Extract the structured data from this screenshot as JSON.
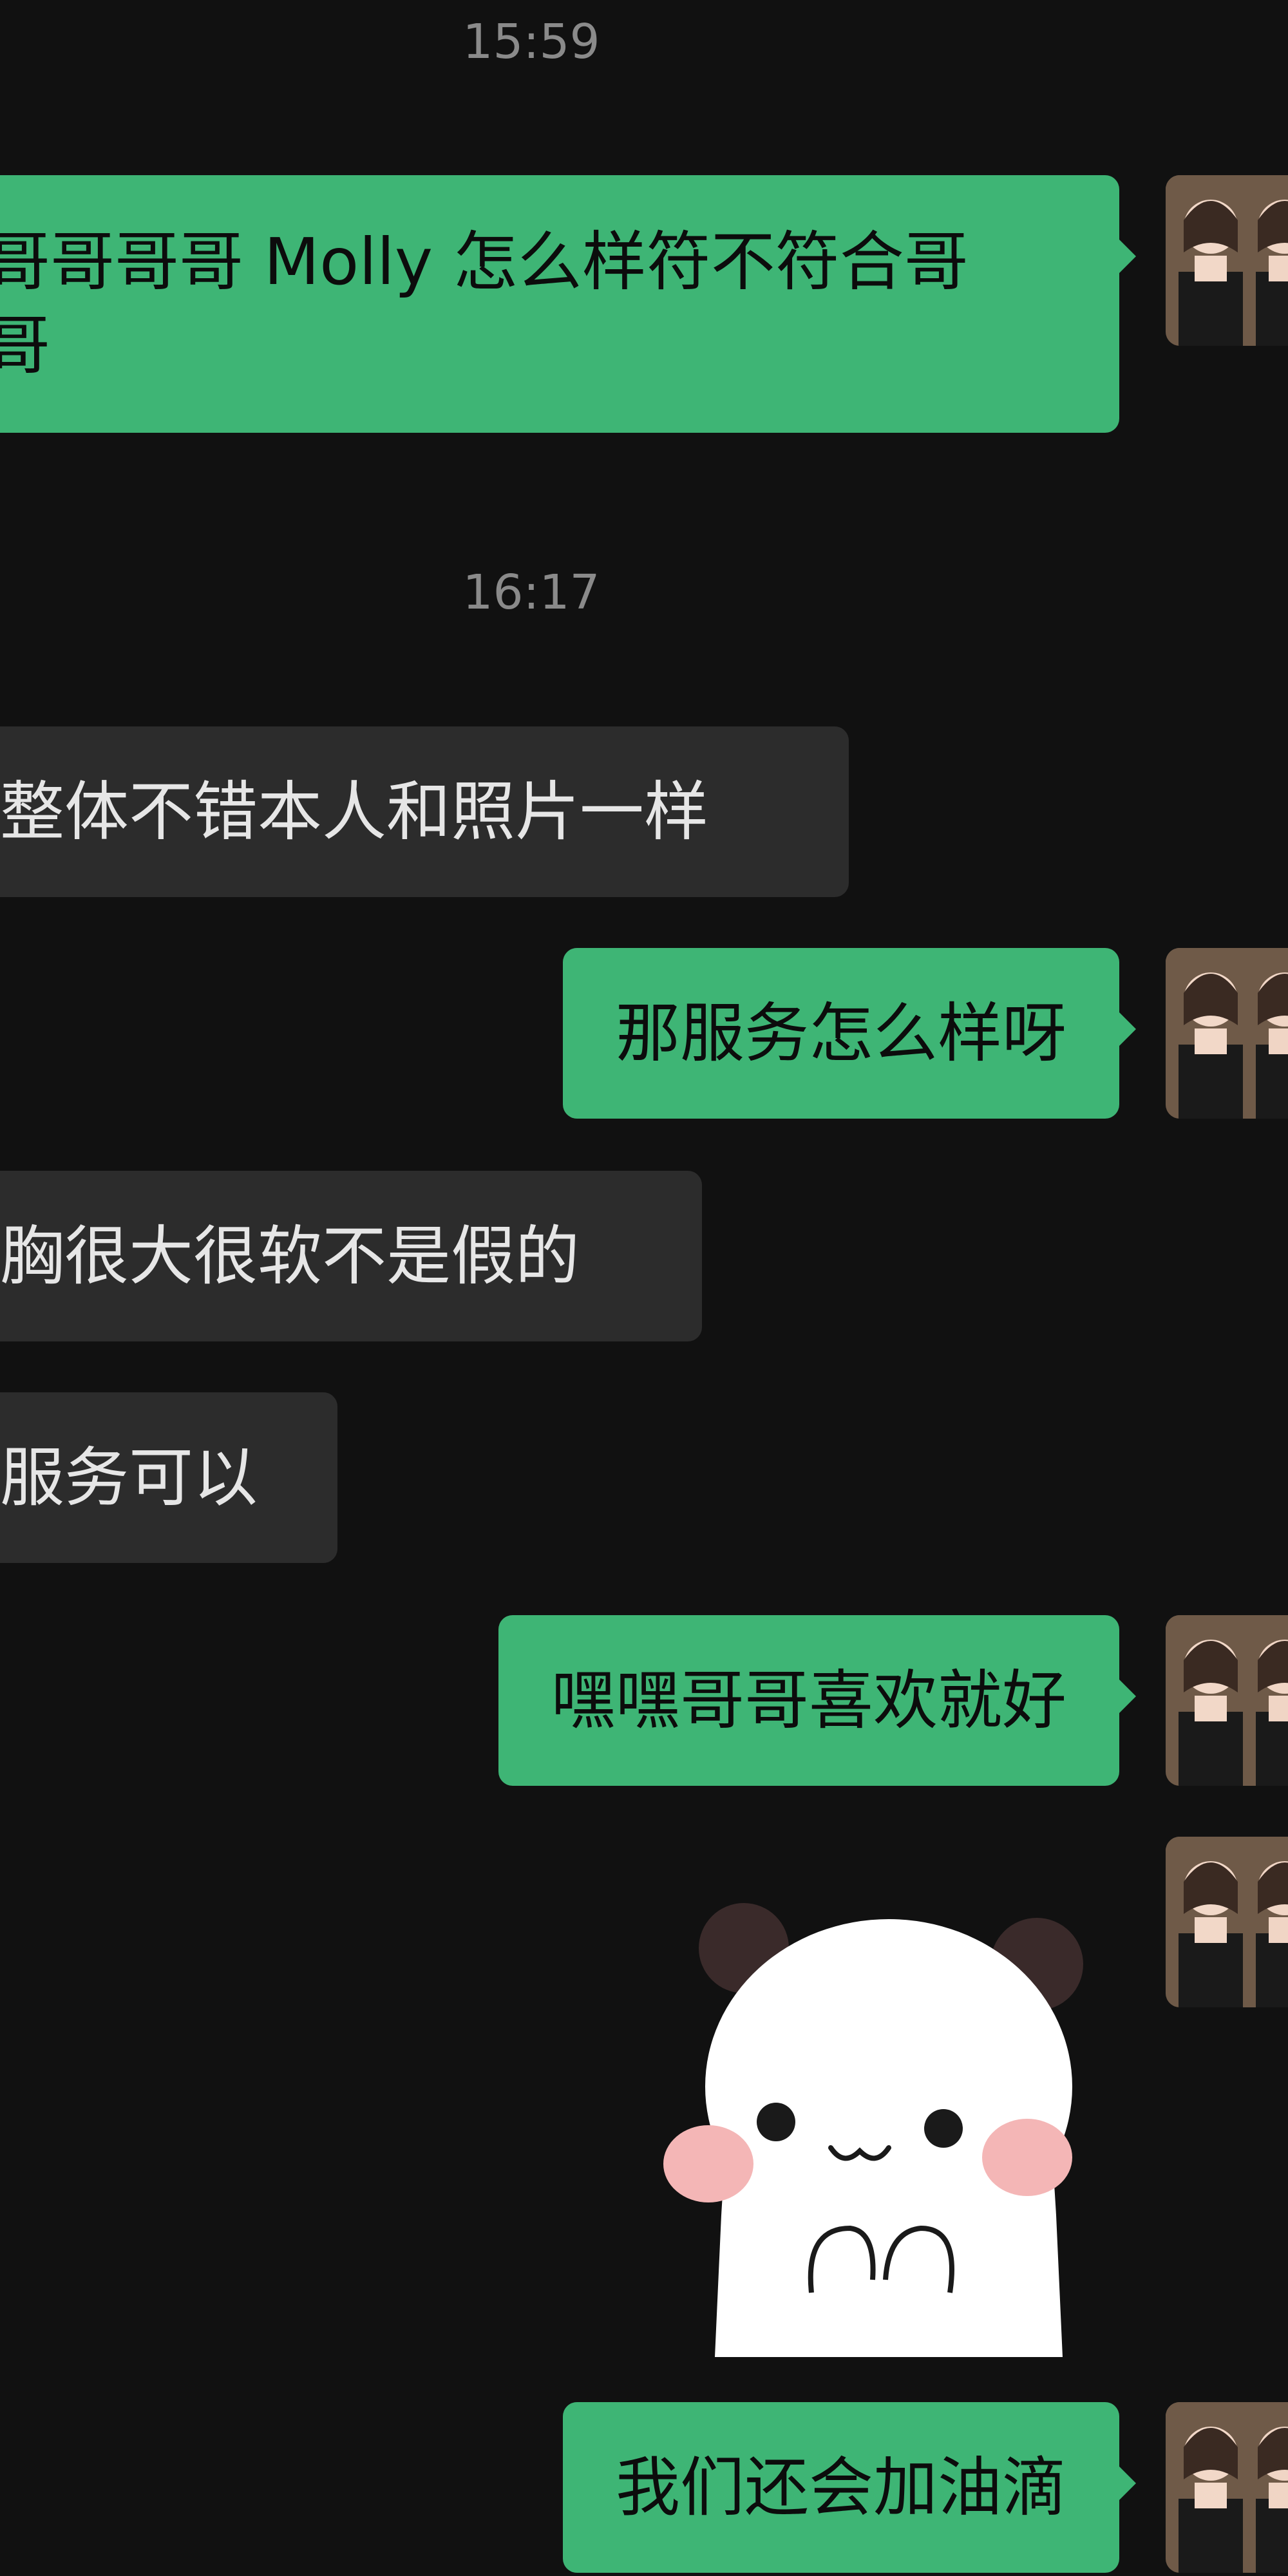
{
  "timestamps": [
    "15:59",
    "16:17"
  ],
  "messages": {
    "m1_line1": "哥哥哥哥 Molly 怎么样符不符合哥",
    "m1_line2": "哥",
    "m2": "整体不错本人和照片一样",
    "m3": "那服务怎么样呀",
    "m4": "胸很大很软不是假的",
    "m5": "服务可以",
    "m6": "嘿嘿哥哥喜欢就好",
    "m8": "我们还会加油滴"
  },
  "sticker": {
    "name": "panda-sticker"
  },
  "colors": {
    "background": "#111111",
    "outgoing_bubble": "#3eb575",
    "incoming_bubble": "#2c2c2c",
    "timestamp": "#8a8a8a"
  }
}
